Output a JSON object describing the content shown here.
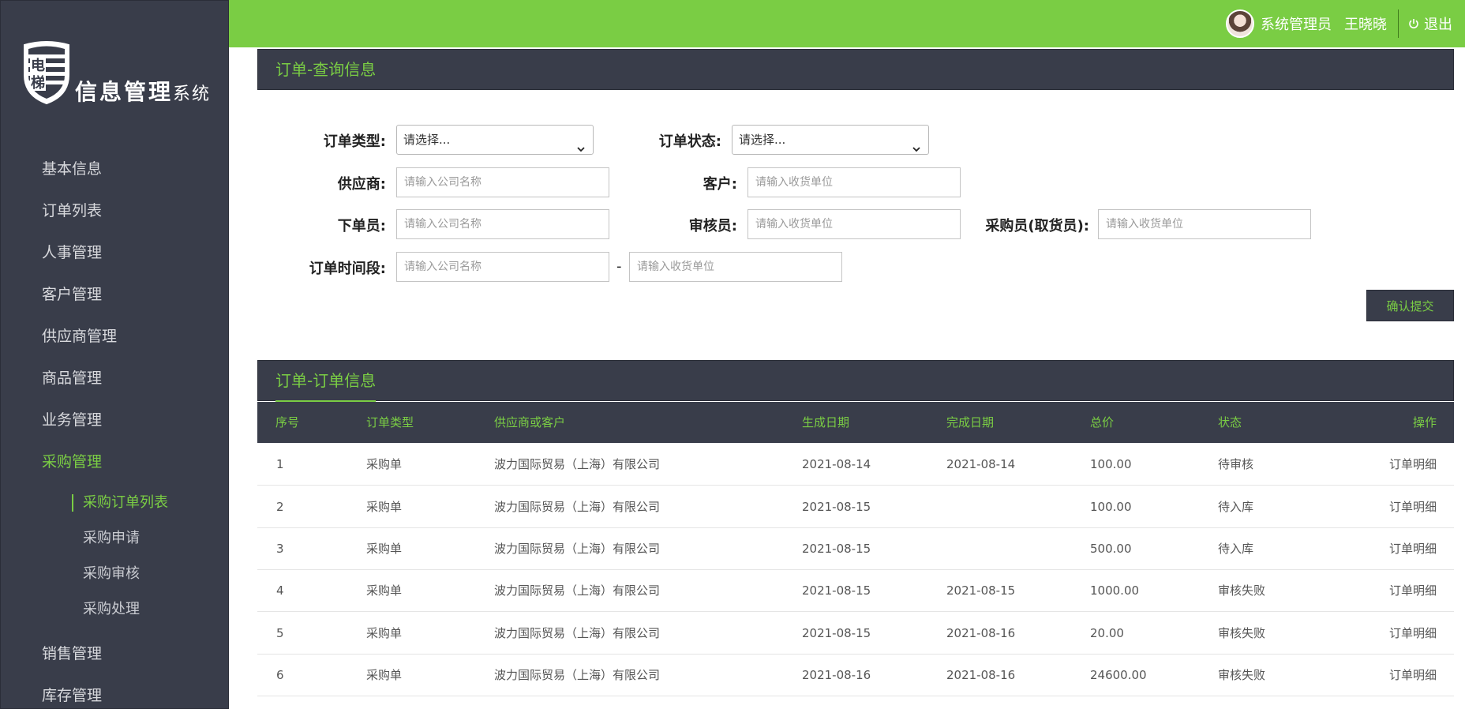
{
  "logo": {
    "seal_text": "电梯",
    "title_main": "信息管理",
    "title_small": "系统"
  },
  "sidebar": {
    "items": [
      {
        "label": "基本信息"
      },
      {
        "label": "订单列表"
      },
      {
        "label": "人事管理"
      },
      {
        "label": "客户管理"
      },
      {
        "label": "供应商管理"
      },
      {
        "label": "商品管理"
      },
      {
        "label": "业务管理"
      },
      {
        "label": "采购管理",
        "active": true
      }
    ],
    "sub_items": [
      {
        "label": "采购订单列表",
        "active": true
      },
      {
        "label": "采购申请"
      },
      {
        "label": "采购审核"
      },
      {
        "label": "采购处理"
      }
    ],
    "after_items": [
      {
        "label": "销售管理"
      },
      {
        "label": "库存管理"
      }
    ]
  },
  "header": {
    "role": "系统管理员",
    "username": "王晓晓",
    "logout": "退出"
  },
  "query_panel": {
    "title": "订单-查询信息",
    "order_type": {
      "label": "订单类型:",
      "value": "请选择..."
    },
    "order_status": {
      "label": "订单状态:",
      "value": "请选择..."
    },
    "supplier": {
      "label": "供应商:",
      "placeholder": "请输入公司名称"
    },
    "customer": {
      "label": "客户:",
      "placeholder": "请输入收货单位"
    },
    "orderer": {
      "label": "下单员:",
      "placeholder": "请输入公司名称"
    },
    "auditor": {
      "label": "审核员:",
      "placeholder": "请输入收货单位"
    },
    "buyer": {
      "label": "采购员(取货员):",
      "placeholder": "请输入收货单位"
    },
    "period": {
      "label": "订单时间段:",
      "start_placeholder": "请输入公司名称",
      "separator": "-",
      "end_placeholder": "请输入收货单位"
    },
    "submit": "确认提交"
  },
  "orders_panel": {
    "title": "订单-订单信息",
    "columns": [
      "序号",
      "订单类型",
      "供应商或客户",
      "生成日期",
      "完成日期",
      "总价",
      "状态",
      "操作"
    ],
    "rows": [
      {
        "no": "1",
        "type": "采购单",
        "party": "波力国际贸易（上海）有限公司",
        "created": "2021-08-14",
        "completed": "2021-08-14",
        "total": "100.00",
        "status": "待审核",
        "action": "订单明细"
      },
      {
        "no": "2",
        "type": "采购单",
        "party": "波力国际贸易（上海）有限公司",
        "created": "2021-08-15",
        "completed": "",
        "total": "100.00",
        "status": "待入库",
        "action": "订单明细"
      },
      {
        "no": "3",
        "type": "采购单",
        "party": "波力国际贸易（上海）有限公司",
        "created": "2021-08-15",
        "completed": "",
        "total": "500.00",
        "status": "待入库",
        "action": "订单明细"
      },
      {
        "no": "4",
        "type": "采购单",
        "party": "波力国际贸易（上海）有限公司",
        "created": "2021-08-15",
        "completed": "2021-08-15",
        "total": "1000.00",
        "status": "审核失败",
        "action": "订单明细"
      },
      {
        "no": "5",
        "type": "采购单",
        "party": "波力国际贸易（上海）有限公司",
        "created": "2021-08-15",
        "completed": "2021-08-16",
        "total": "20.00",
        "status": "审核失败",
        "action": "订单明细"
      },
      {
        "no": "6",
        "type": "采购单",
        "party": "波力国际贸易（上海）有限公司",
        "created": "2021-08-16",
        "completed": "2021-08-16",
        "total": "24600.00",
        "status": "审核失败",
        "action": "订单明细"
      }
    ]
  },
  "colors": {
    "accent": "#7acd44",
    "dark_panel": "#393d4a"
  }
}
